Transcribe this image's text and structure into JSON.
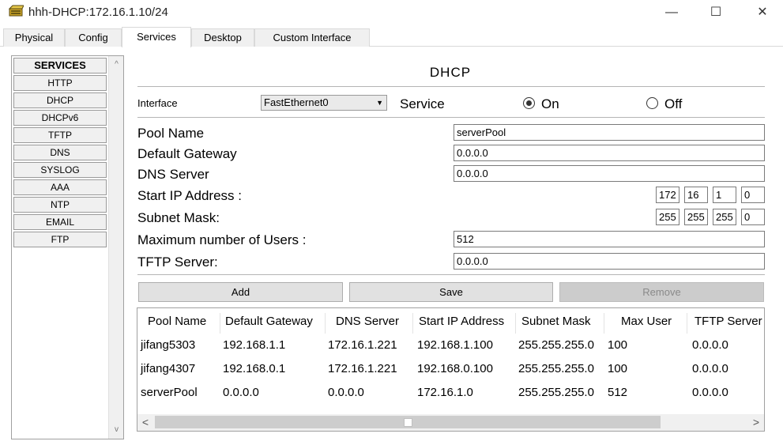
{
  "window": {
    "title": "hhh-DHCP:172.16.1.10/24",
    "minimize": "—",
    "maximize": "☐",
    "close": "✕"
  },
  "tabs": [
    {
      "label": "Physical"
    },
    {
      "label": "Config"
    },
    {
      "label": "Services",
      "active": true
    },
    {
      "label": "Desktop"
    },
    {
      "label": "Custom Interface"
    }
  ],
  "sidebar": {
    "header": "SERVICES",
    "items": [
      "HTTP",
      "DHCP",
      "DHCPv6",
      "TFTP",
      "DNS",
      "SYSLOG",
      "AAA",
      "NTP",
      "EMAIL",
      "FTP"
    ]
  },
  "dhcp": {
    "title": "DHCP",
    "interface_label": "Interface",
    "interface_value": "FastEthernet0",
    "service_label": "Service",
    "on_label": "On",
    "off_label": "Off",
    "service_state": "On",
    "pool_name_label": "Pool Name",
    "pool_name": "serverPool",
    "gateway_label": "Default Gateway",
    "gateway": "0.0.0.0",
    "dns_label": "DNS Server",
    "dns": "0.0.0.0",
    "start_ip_label": "Start IP Address :",
    "start_ip": [
      "172",
      "16",
      "1",
      "0"
    ],
    "mask_label": "Subnet Mask:",
    "mask": [
      "255",
      "255",
      "255",
      "0"
    ],
    "max_users_label": "Maximum number of Users :",
    "max_users": "512",
    "tftp_label": "TFTP Server:",
    "tftp": "0.0.0.0"
  },
  "buttons": {
    "add": "Add",
    "save": "Save",
    "remove": "Remove"
  },
  "table": {
    "columns": [
      "Pool Name",
      "Default Gateway",
      "DNS Server",
      "Start IP Address",
      "Subnet Mask",
      "Max User",
      "TFTP Server"
    ],
    "rows": [
      [
        "jifang5303",
        "192.168.1.1",
        "172.16.1.221",
        "192.168.1.100",
        "255.255.255.0",
        "100",
        "0.0.0.0"
      ],
      [
        "jifang4307",
        "192.168.0.1",
        "172.16.1.221",
        "192.168.0.100",
        "255.255.255.0",
        "100",
        "0.0.0.0"
      ],
      [
        "serverPool",
        "0.0.0.0",
        "0.0.0.0",
        "172.16.1.0",
        "255.255.255.0",
        "512",
        "0.0.0.0"
      ]
    ]
  },
  "scroll": {
    "up": "^",
    "down": "v",
    "left": "<",
    "right": ">"
  }
}
